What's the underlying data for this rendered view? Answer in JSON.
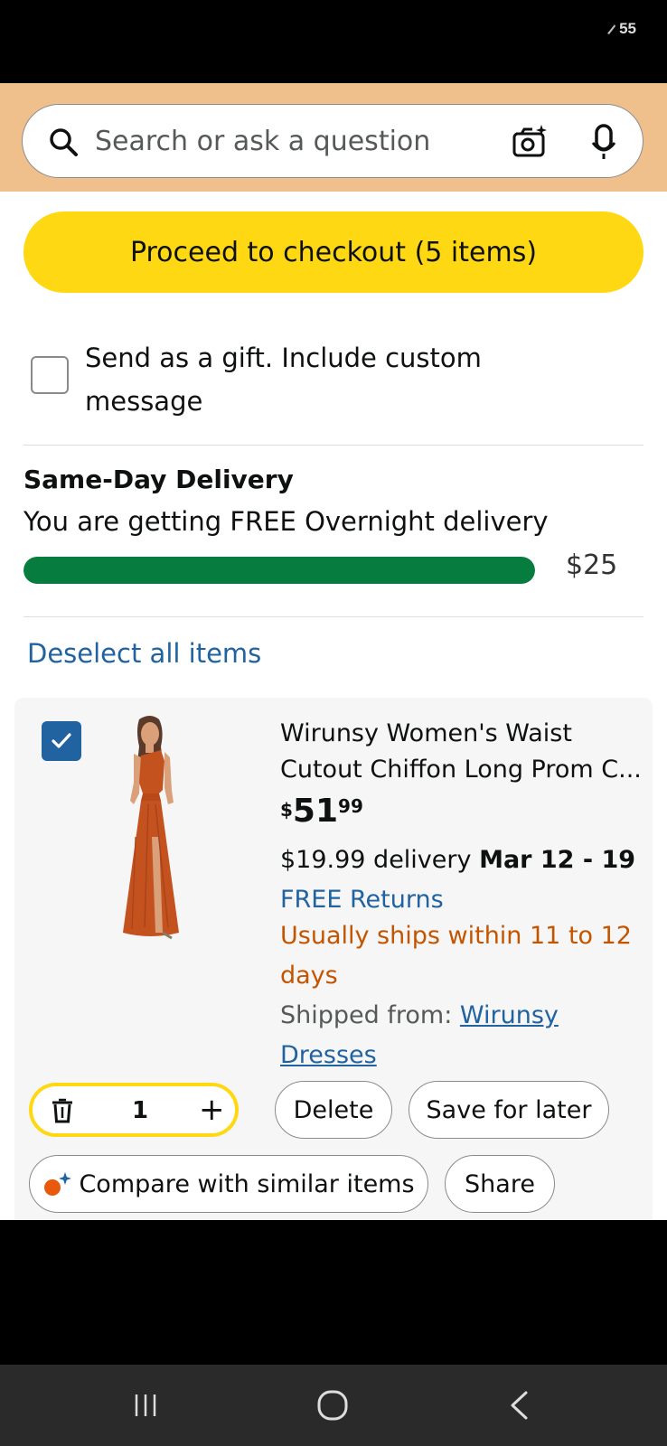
{
  "status_bar": {
    "battery_level": "55"
  },
  "search": {
    "placeholder": "Search or ask a question"
  },
  "checkout": {
    "label": "Proceed to checkout (5 items)"
  },
  "gift": {
    "label": "Send as a gift. Include custom message",
    "checked": false
  },
  "delivery": {
    "title": "Same-Day Delivery",
    "subtitle": "You are getting FREE Overnight delivery",
    "progress_fraction": 1.0,
    "threshold_amount": "$25"
  },
  "deselect_label": "Deselect all items",
  "cart_item": {
    "selected": true,
    "title": "Wirunsy Women's Waist Cutout Chiffon Long Prom C...",
    "price_symbol": "$",
    "price_whole": "51",
    "price_fraction": "99",
    "delivery_fee": "$19.99 delivery",
    "delivery_dates": "Mar 12 - 19",
    "returns": "FREE Returns",
    "ships_note": "Usually ships within 11 to 12 days",
    "shipped_from_label": "Shipped from:",
    "seller": "Wirunsy Dresses",
    "quantity": "1",
    "delete_label": "Delete",
    "save_label": "Save for later",
    "compare_label": "Compare with similar items",
    "share_label": "Share",
    "image_colors": {
      "dress": "#c4521f",
      "skin": "#d9a07a",
      "hair": "#5a3a28"
    }
  },
  "colors": {
    "search_band": "#f0c08c",
    "checkout_button": "#ffd814",
    "progress_fill": "#067d3f",
    "link": "#2162a1",
    "ships_note": "#c45500"
  },
  "navigation": {
    "recents_icon": "recents-icon",
    "home_icon": "home-icon",
    "back_icon": "back-icon"
  }
}
